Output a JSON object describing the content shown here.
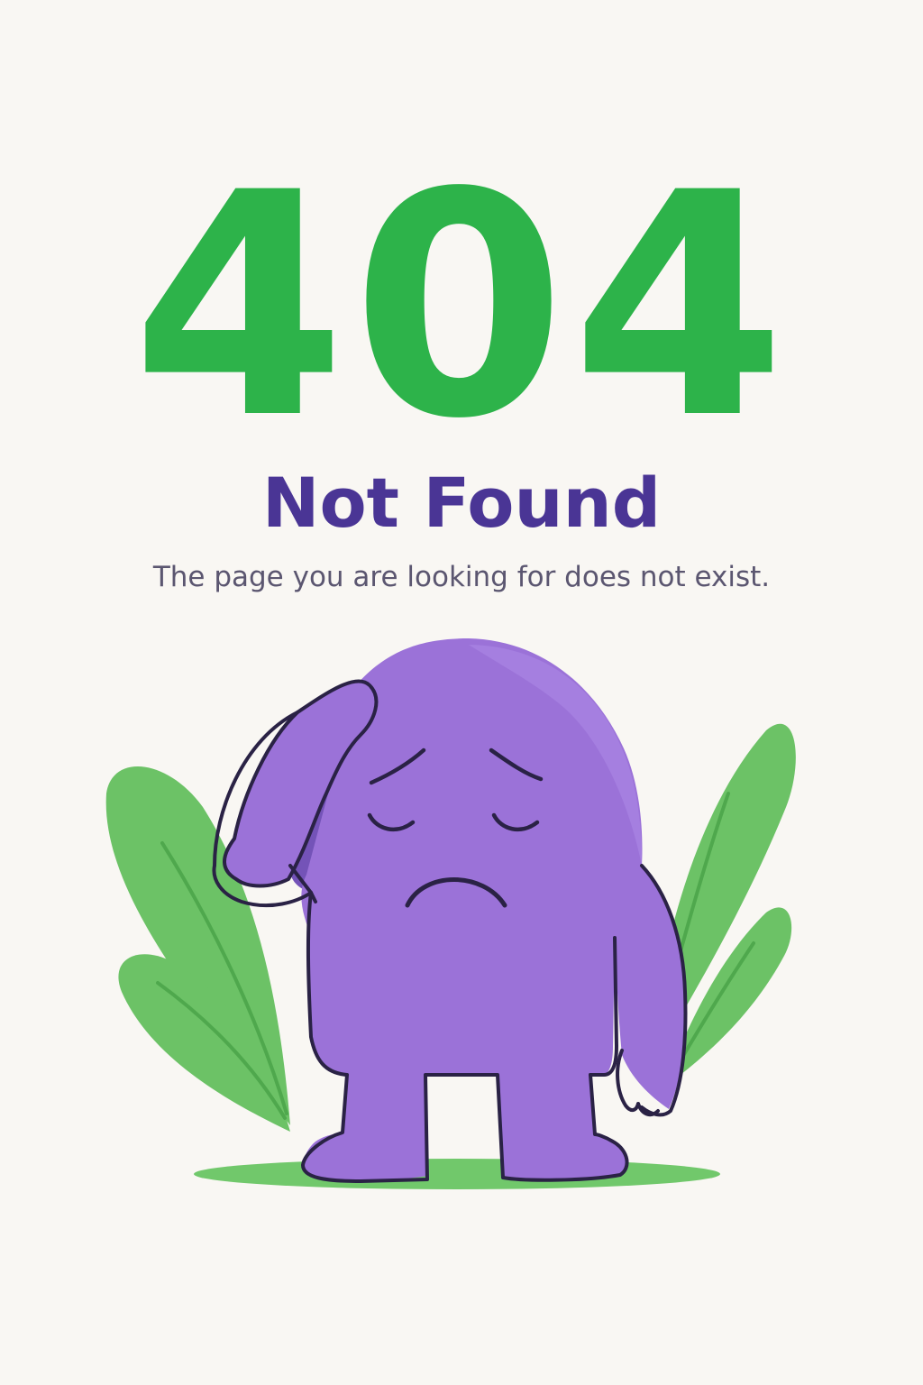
{
  "error": {
    "code": "404",
    "title": "Not Found",
    "message": "The page you are looking for does not exist."
  },
  "illustration": {
    "character": "sad-purple-blob-character",
    "decoration": "green-leaves"
  },
  "colors": {
    "background": "#f9f7f3",
    "code": "#2db34a",
    "title": "#4a3595",
    "message": "#5b5670",
    "character": "#9b72d8",
    "outline": "#2a2245",
    "leaf": "#6cc266",
    "leaf_vein": "#4fa84d",
    "ground": "#71c86b"
  }
}
